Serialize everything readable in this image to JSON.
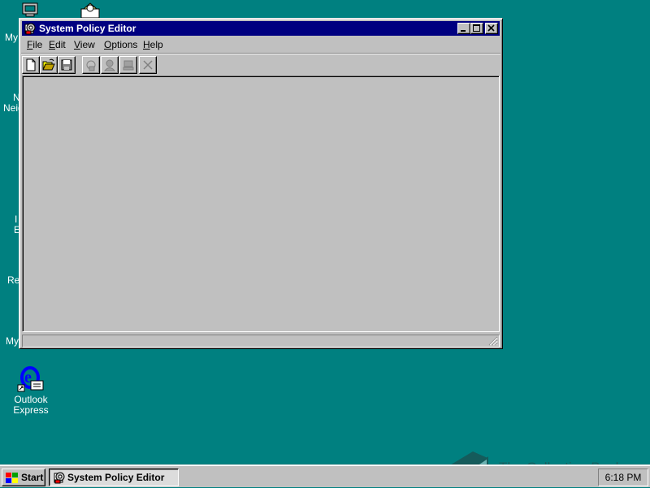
{
  "desktop": {
    "partial_labels": [
      "My",
      "N",
      "Neig",
      "I",
      "E",
      "Re",
      "My"
    ],
    "outlook": {
      "line1": "Outlook",
      "line2": "Express"
    }
  },
  "window": {
    "title": "System Policy Editor",
    "menu": [
      {
        "accel": "F",
        "rest": "ile"
      },
      {
        "accel": "E",
        "rest": "dit"
      },
      {
        "accel": "V",
        "rest": "iew"
      },
      {
        "accel": "O",
        "rest": "ptions"
      },
      {
        "accel": "H",
        "rest": "elp"
      }
    ],
    "toolbar_icons": [
      "new-document-icon",
      "open-folder-icon",
      "save-disk-icon",
      "properties-icon",
      "add-user-icon",
      "add-computer-icon",
      "remove-x-icon"
    ]
  },
  "taskbar": {
    "start_label": "Start",
    "task_label": "System Policy Editor",
    "clock": "6:18 PM"
  },
  "watermark": {
    "text": "The Collection Book"
  },
  "colors": {
    "desktop": "#008080",
    "titlebar": "#000080",
    "face": "#c0c0c0"
  }
}
